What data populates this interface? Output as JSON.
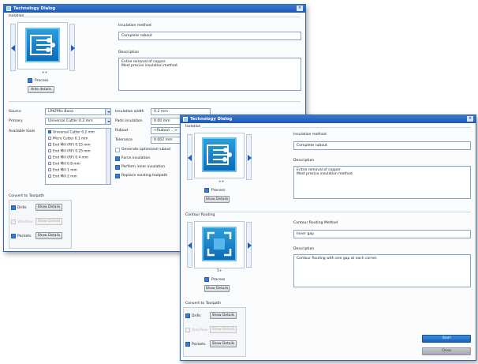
{
  "colors": {
    "accent": "#1f58b0",
    "thumb": "#0d6bb8",
    "checked": "#2f7fd8"
  },
  "back_dialog": {
    "title": "Technology Dialog",
    "section_label": "Isolation",
    "insulation_method_label": "Insulation method",
    "insulation_method_value": "Complete rubout",
    "description_label": "Description",
    "description_text": "Entire removal of copper.\nMost precise insulation method.",
    "process_label": "Process",
    "show_details": "Hide details",
    "preview_caption": "++",
    "source_label": "Source",
    "source_value": "LPKFMix Basic",
    "primary_label": "Primary",
    "primary_value": "Universal Cutter 0.2 mm",
    "available_tools_label": "Available tools",
    "tools": [
      {
        "label": "Universal Cutter 0.2 mm",
        "checked": true
      },
      {
        "label": "Micro Cutter 0.1 mm",
        "checked": false
      },
      {
        "label": "End Mill (RF) 0.15 mm",
        "checked": false
      },
      {
        "label": "End Mill (RF) 0.25 mm",
        "checked": false
      },
      {
        "label": "End Mill (RF) 0.4 mm",
        "checked": false
      },
      {
        "label": "End Mill 0.8 mm",
        "checked": false
      },
      {
        "label": "End Mill 1 mm",
        "checked": false
      },
      {
        "label": "End Mill 2 mm",
        "checked": false
      }
    ],
    "insulation_width_label": "Insulation width",
    "insulation_width_value": "0.2 mm",
    "pads_insulation_label": "Pads insulation",
    "pads_insulation_value": "0.00 mm",
    "rubout_label": "Rubout",
    "rubout_value": "<Rubout ...>",
    "tolerance_label": "Tolerance",
    "tolerance_value": "0.002 mm",
    "options": [
      {
        "label": "Generate optimized rubout",
        "checked": false
      },
      {
        "label": "Force insulation",
        "checked": true
      },
      {
        "label": "Perform inner insulation",
        "checked": true
      },
      {
        "label": "Replace existing toolpath",
        "checked": true
      }
    ],
    "convert_label": "Convert to Toolpath",
    "convert_rows": [
      {
        "label": "Drills",
        "button": "Show Details",
        "state": "checked"
      },
      {
        "label": "Vias/Aux",
        "button": "Show Details",
        "state": "disabled"
      },
      {
        "label": "Pockets",
        "button": "Show Details",
        "state": "checked"
      }
    ]
  },
  "front_dialog": {
    "title": "Technology Dialog",
    "section_label": "Isolation",
    "insulation_method_label": "Insulation method",
    "insulation_method_value": "Complete rubout",
    "description_label": "Description",
    "description_text": "Entire removal of copper.\nMost precise insulation method.",
    "process_label": "Process",
    "show_details": "Show Details",
    "preview_caption": "++",
    "contour_section_label": "Contour Routing",
    "contour_method_label": "Contour Routing Method",
    "contour_method_value": "Inner gap",
    "contour_description_label": "Description",
    "contour_description_text": "Contour Routing with one gap at each corner.",
    "contour_process_label": "Process",
    "contour_show_details": "Show Details",
    "contour_preview_caption": "5+",
    "convert_label": "Convert to Toolpath",
    "convert_rows": [
      {
        "label": "Drills",
        "button": "Show Details",
        "state": "checked"
      },
      {
        "label": "Vias/Aux",
        "button": "Show Details",
        "state": "disabled"
      },
      {
        "label": "Pockets",
        "button": "Show Details",
        "state": "checked"
      }
    ],
    "start_label": "Start",
    "close_label": "Close"
  }
}
